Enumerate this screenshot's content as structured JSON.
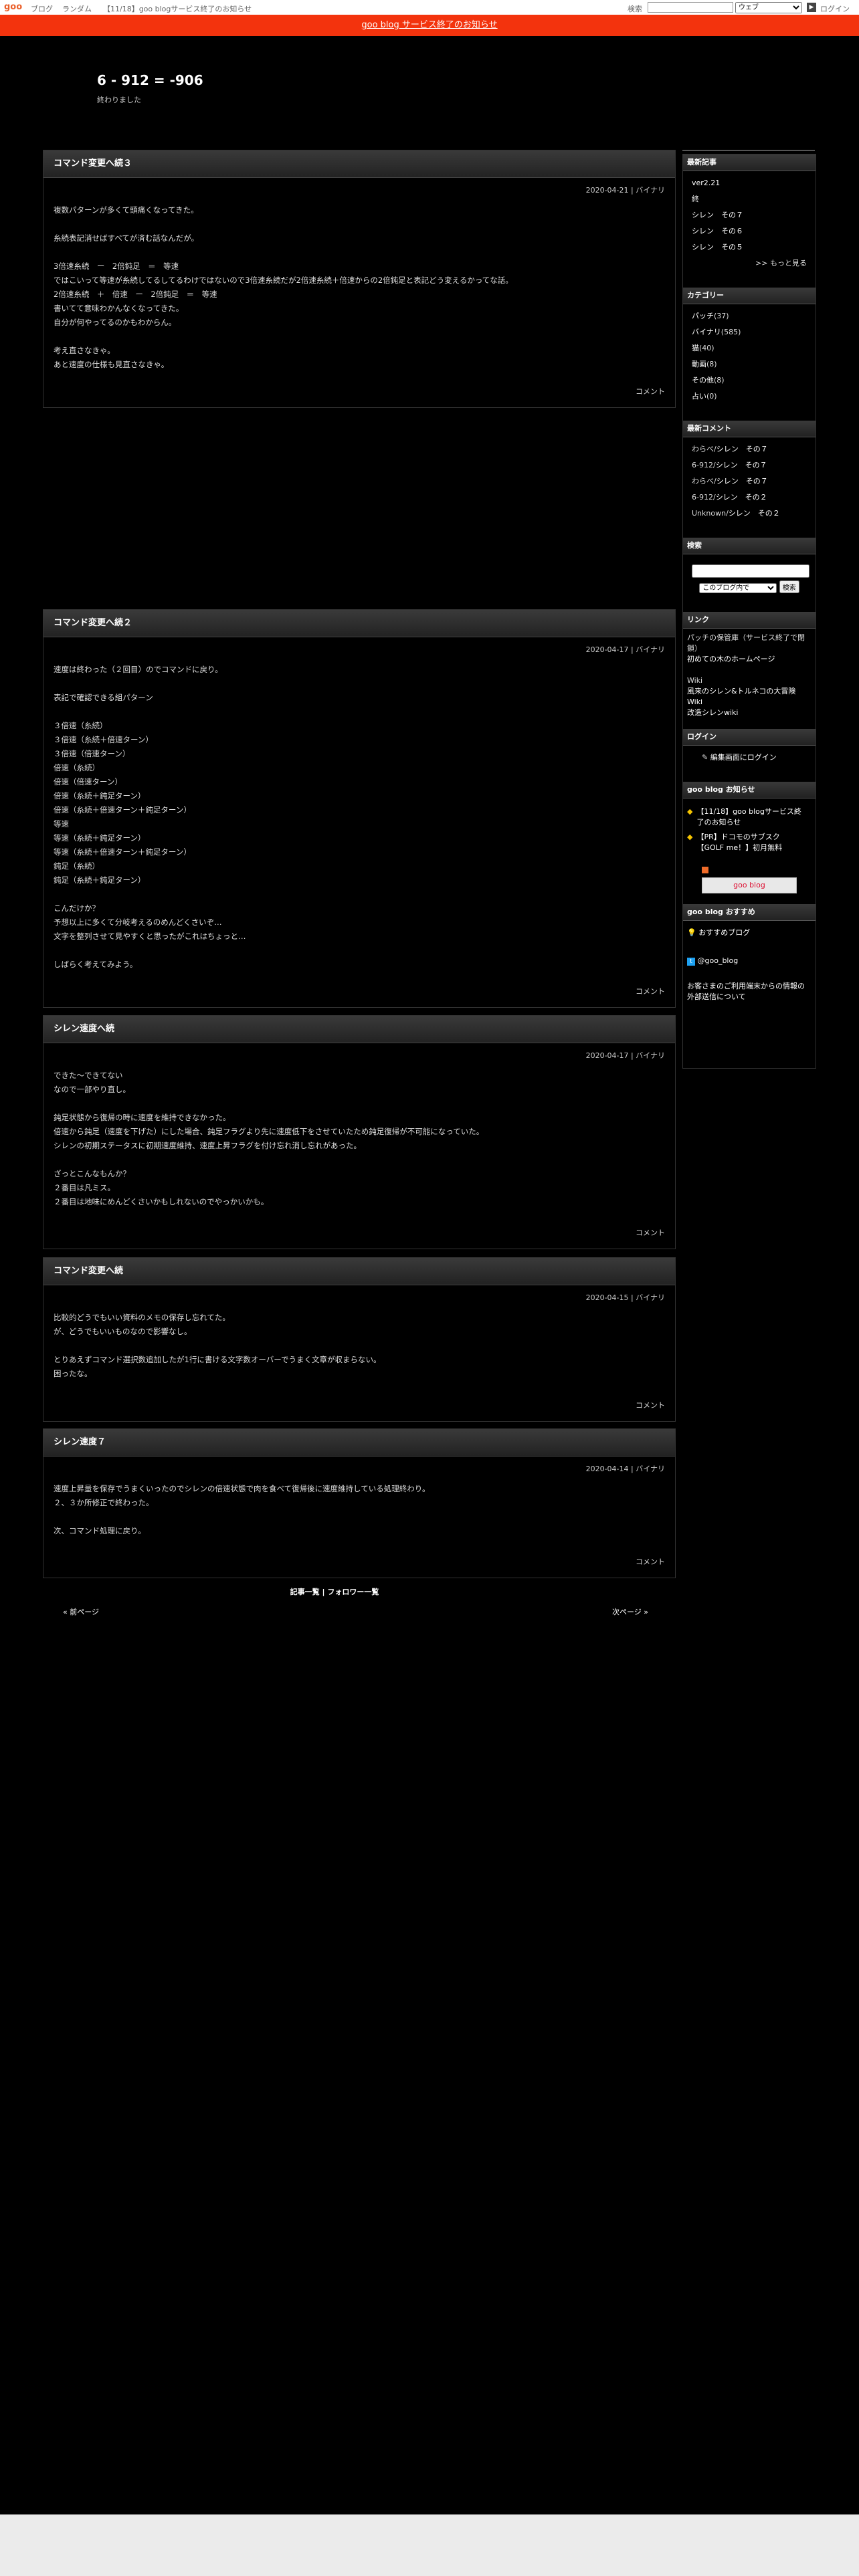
{
  "topbar": {
    "logo": "goo",
    "links": [
      "ブログ",
      "ランダム",
      "【11/18】goo blogサービス終了のお知らせ"
    ],
    "search_label": "検索",
    "search_value": "",
    "scope_option": "ウェブ",
    "login": "ログイン"
  },
  "notice": {
    "text": "goo blog サービス終了のお知らせ"
  },
  "blog": {
    "title": "6 - 912 = -906",
    "description": "終わりました"
  },
  "entries": [
    {
      "title": "コマンド変更へ続３",
      "meta": "2020-04-21 | バイナリ",
      "body": "複数パターンが多くて頭痛くなってきた。\n\n糸続表記消せばすべてが済む話なんだが。\n\n3倍速糸続　ー　2倍鈍足　＝　等速\nではこいって等速が糸続してるしてるわけではないので3倍速糸続だが2倍速糸続＋倍速からの2倍鈍足と表記どう変えるかってな話。\n2倍速糸続　＋　倍速　ー　2倍鈍足　＝　等速\n書いてて意味わかんなくなってきた。\n自分が何やってるのかもわからん。\n\n考え直さなきゃ。\nあと速度の仕様も見直さなきゃ。",
      "footer": "コメント"
    },
    {
      "title": "コマンド変更へ続２",
      "meta": "2020-04-17 | バイナリ",
      "body": "速度は終わった（２回目）のでコマンドに戻り。\n\n表記で確認できる組パターン\n\n３倍速（糸続）\n３倍速（糸続＋倍速ターン）\n３倍速（倍速ターン）\n倍速（糸続）\n倍速（倍速ターン）\n倍速（糸続＋鈍足ターン）\n倍速（糸続＋倍速ターン＋鈍足ターン）\n等速\n等速（糸続＋鈍足ターン）\n等速（糸続＋倍速ターン＋鈍足ターン）\n鈍足（糸続）\n鈍足（糸続＋鈍足ターン）\n\nこんだけか？\n予想以上に多くて分岐考えるのめんどくさいぞ…\n文字を整列させて見やすくと思ったがこれはちょっと…\n\nしばらく考えてみよう。",
      "footer": "コメント"
    },
    {
      "title": "シレン速度へ続",
      "meta": "2020-04-17 | バイナリ",
      "body": "できた～できてない\nなので一部やり直し。\n\n鈍足状態から復帰の時に速度を維持できなかった。\n倍速から鈍足（速度を下げた）にした場合、鈍足フラグより先に速度低下をさせていたため鈍足復帰が不可能になっていた。\nシレンの初期ステータスに初期速度維持、速度上昇フラグを付け忘れ消し忘れがあった。\n\nざっとこんなもんか？\n２番目は凡ミス。\n２番目は地味にめんどくさいかもしれないのでやっかいかも。",
      "footer": "コメント"
    },
    {
      "title": "コマンド変更へ続",
      "meta": "2020-04-15 | バイナリ",
      "body": "比較的どうでもいい資料のメモの保存し忘れてた。\nが、どうでもいいものなので影響なし。\n\nとりあえずコマンド選択数追加したが1行に書ける文字数オーバーでうまく文章が収まらない。\n困ったな。",
      "footer": "コメント"
    },
    {
      "title": "シレン速度７",
      "meta": "2020-04-14 | バイナリ",
      "body": "速度上昇量を保存でうまくいったのでシレンの倍速状態で肉を食べて復帰後に速度維持している処理終わり。\n２、３か所修正で終わった。\n\n次、コマンド処理に戻り。",
      "footer": "コメント"
    }
  ],
  "sidebar": {
    "recent": {
      "heading": "最新記事",
      "items": [
        "ver2.21",
        "終",
        "シレン　その７",
        "シレン　その６",
        "シレン　その５"
      ],
      "more": ">> もっと見る"
    },
    "categories": {
      "heading": "カテゴリー",
      "items": [
        {
          "name": "パッチ",
          "count": "(37)"
        },
        {
          "name": "バイナリ",
          "count": "(585)"
        },
        {
          "name": "猫",
          "count": "(40)"
        },
        {
          "name": "動画",
          "count": "(8)"
        },
        {
          "name": "その他",
          "count": "(8)"
        },
        {
          "name": "占い",
          "count": "(0)"
        }
      ]
    },
    "comments": {
      "heading": "最新コメント",
      "items": [
        {
          "author": "わらべ",
          "link": "シレン　その７"
        },
        {
          "author": "6-912",
          "link": "シレン　その７"
        },
        {
          "author": "わらべ",
          "link": "シレン　その７"
        },
        {
          "author": "6-912",
          "link": "シレン　その２"
        },
        {
          "author": "Unknown",
          "link": "シレン　その２"
        }
      ]
    },
    "search": {
      "heading": "検索",
      "input_value": "",
      "scope": "このブログ内で",
      "button": "検索"
    },
    "links": {
      "heading": "リンク",
      "items": [
        {
          "prefix": "パッチの保管庫（サービス終了で閉鎖）",
          "text": ""
        },
        {
          "prefix": "",
          "text": "初めての木のホームページ"
        },
        {
          "prefix": "Wiki",
          "text": ""
        },
        {
          "prefix": "",
          "text": "風来のシレン&トルネコの大冒険 Wiki"
        },
        {
          "prefix": "",
          "text": "改造シレンwiki"
        }
      ]
    },
    "login": {
      "heading": "ログイン",
      "link": "編集画面にログイン"
    },
    "goo_news": {
      "heading": "goo blog お知らせ",
      "items": [
        "【11/18】goo blogサービス終了のお知らせ",
        "【PR】ドコモのサブスク【GOLF me！】初月無料"
      ],
      "badge": "goo blog"
    },
    "goo_recommend": {
      "heading": "goo blog おすすめ",
      "item": "おすすめブログ",
      "twitter": "@goo_blog",
      "notice": "お客さまのご利用端末からの情報の外部送信について"
    }
  },
  "pager": {
    "index": "記事一覧",
    "sep": " | ",
    "follower": "フォロワー一覧",
    "prev": "前ページ",
    "next": "次ページ"
  }
}
